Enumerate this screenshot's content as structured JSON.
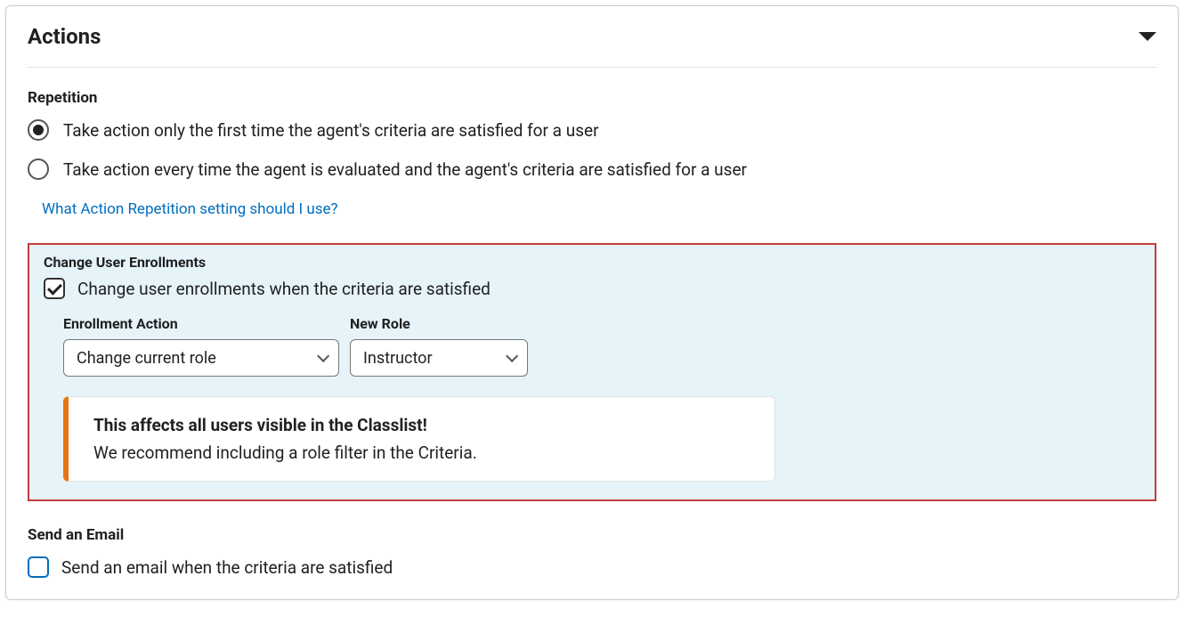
{
  "panel": {
    "title": "Actions"
  },
  "repetition": {
    "label": "Repetition",
    "options": [
      {
        "label": "Take action only the first time the agent's criteria are satisfied for a user",
        "selected": true
      },
      {
        "label": "Take action every time the agent is evaluated and the agent's criteria are satisfied for a user",
        "selected": false
      }
    ],
    "help_link": "What Action Repetition setting should I use?"
  },
  "enrollments": {
    "section_label": "Change User Enrollments",
    "checkbox_label": "Change user enrollments when the criteria are satisfied",
    "checked": true,
    "enrollment_action": {
      "label": "Enrollment Action",
      "value": "Change current role"
    },
    "new_role": {
      "label": "New Role",
      "value": "Instructor"
    },
    "alert": {
      "title": "This affects all users visible in the Classlist!",
      "text": "We recommend including a role filter in the Criteria."
    }
  },
  "email": {
    "section_label": "Send an Email",
    "checkbox_label": "Send an email when the criteria are satisfied",
    "checked": false
  }
}
